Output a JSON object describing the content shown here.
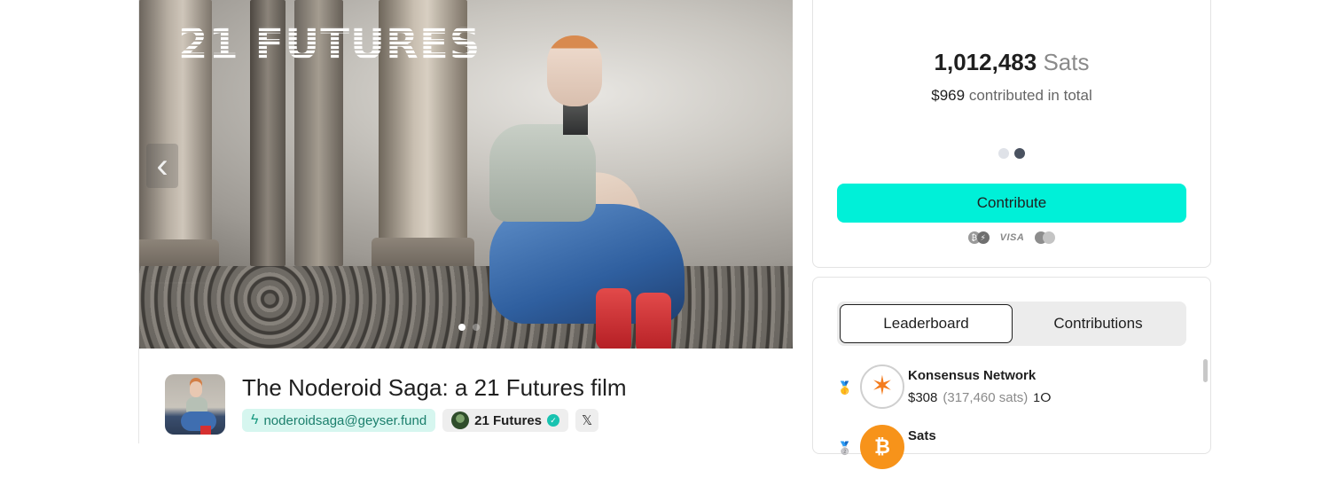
{
  "hero": {
    "title": "21 FUTURES",
    "prev_icon": "chevron-left-icon",
    "slide_count": 2,
    "active_slide": 1
  },
  "project": {
    "title": "The Noderoid Saga: a 21 Futures film",
    "lightning_address": "noderoidsaga@geyser.fund",
    "creator": "21 Futures",
    "social_icon": "x-icon",
    "social_label": "𝕏"
  },
  "funding": {
    "sats_amount": "1,012,483",
    "sats_unit": "Sats",
    "usd_amount": "$969",
    "usd_suffix": "contributed in total",
    "contribute_label": "Contribute",
    "visa_label": "VISA",
    "btc_glyph": "₿",
    "lightning_glyph": "⚡"
  },
  "leaderboard": {
    "tabs": [
      {
        "label": "Leaderboard",
        "active": true
      },
      {
        "label": "Contributions",
        "active": false
      }
    ],
    "entries": [
      {
        "name": "Konsensus Network",
        "usd": "$308",
        "sats": "(317,460 sats)",
        "count": "1",
        "medal": "gold"
      },
      {
        "name": "Sats",
        "usd": "",
        "sats": "",
        "count": "",
        "medal": "silver"
      }
    ]
  },
  "colors": {
    "accent": "#00f0d8",
    "lightning_chip_bg": "#d6f6ef",
    "verified": "#18c3b0"
  }
}
